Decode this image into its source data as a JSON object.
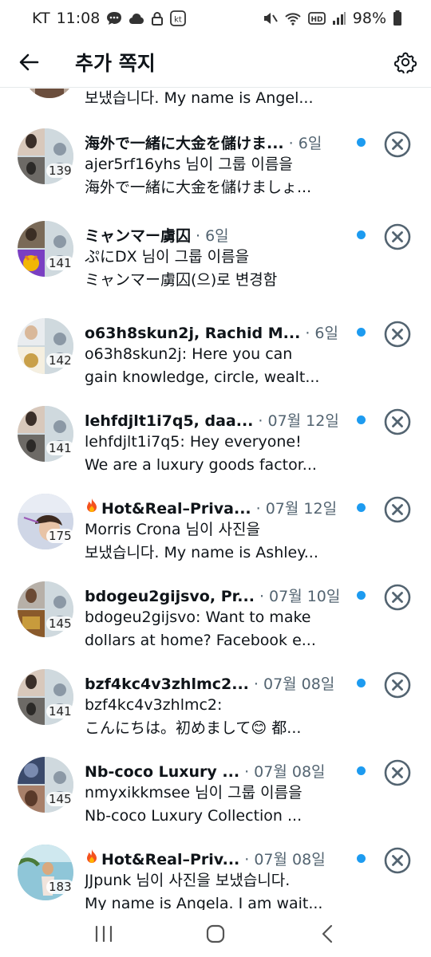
{
  "status_bar": {
    "carrier": "KT",
    "time": "11:08",
    "battery": "98%"
  },
  "header": {
    "title": "추가 쪽지"
  },
  "partial_row": {
    "text": "보냈습니다. My name is Angel..."
  },
  "conversations": [
    {
      "name": "海外で一緒に大金を儲けま...",
      "time": "· 6일",
      "line1": "ajer5rf16yhs 님이 그룹 이름을",
      "line2": "海外で一緒に大金を儲けましょ...",
      "count": "139",
      "flame": false
    },
    {
      "name": "ミャンマー虜囚",
      "time": "· 6일",
      "line1": "ぷにDX 님이 그룹 이름을",
      "line2": "ミャンマー虜囚(으)로 변경함",
      "count": "141",
      "flame": false
    },
    {
      "name": "o63h8skun2j, Rachid M...",
      "time": "· 6일",
      "line1": "o63h8skun2j: Here you can",
      "line2": "gain knowledge, circle, wealt...",
      "count": "142",
      "flame": false
    },
    {
      "name": "lehfdjlt1i7q5, daa...",
      "time": "· 07월 12일",
      "line1": "lehfdjlt1i7q5: Hey everyone!",
      "line2": "We are a luxury goods factor...",
      "count": "141",
      "flame": false
    },
    {
      "name": "Hot&Real–Priva...",
      "time": "· 07월 12일",
      "line1": "Morris Crona 님이 사진을",
      "line2": "보냈습니다. My name is Ashley...",
      "count": "175",
      "flame": true
    },
    {
      "name": "bdogeu2gijsvo, Pr...",
      "time": "· 07월 10일",
      "line1": "bdogeu2gijsvo: Want to make",
      "line2": "dollars at home? Facebook e...",
      "count": "145",
      "flame": false
    },
    {
      "name": "bzf4kc4v3zhlmc2...",
      "time": "· 07월 08일",
      "line1": "bzf4kc4v3zhlmc2:",
      "line2": "こんにちは。初めまして😊  都...",
      "count": "141",
      "flame": false
    },
    {
      "name": "Nb-coco Luxury ...",
      "time": "· 07월 08일",
      "line1": "nmyxikkmsee 님이 그룹 이름을",
      "line2": "Nb-coco Luxury Collection ...",
      "count": "145",
      "flame": false
    },
    {
      "name": "Hot&Real–Priv...",
      "time": "· 07월 08일",
      "line1": "JJpunk 님이 사진을 보냈습니다.",
      "line2": "My name is Angela. I am wait...",
      "count": "183",
      "flame": true
    }
  ],
  "colors": {
    "accent": "#1d9bf0",
    "text": "#0f1419",
    "secondary": "#536471",
    "icon": "#536471"
  }
}
